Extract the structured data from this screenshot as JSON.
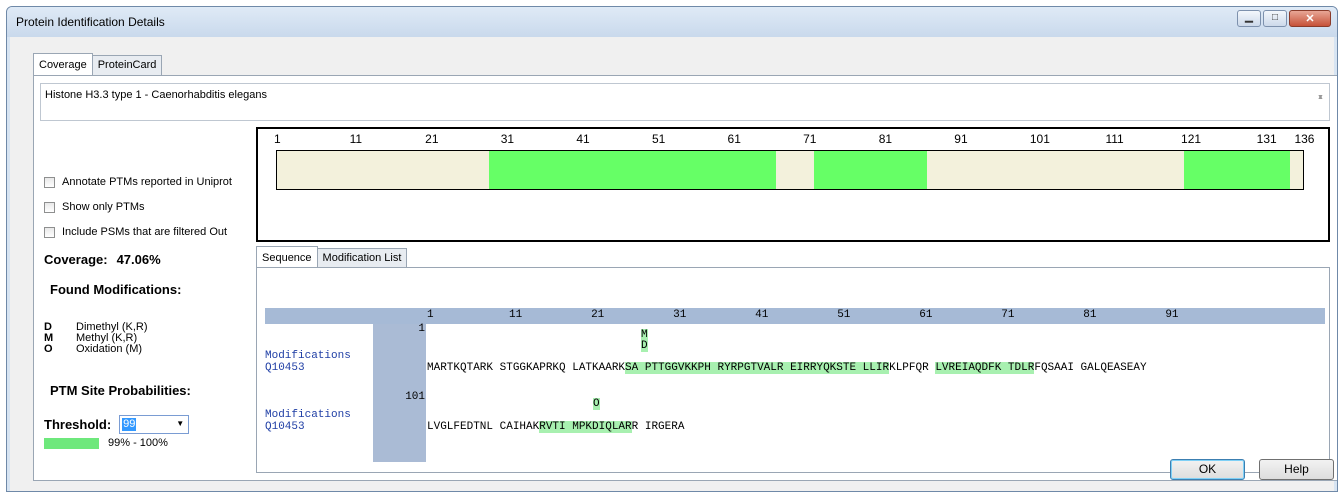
{
  "window": {
    "title": "Protein Identification Details"
  },
  "tabs": [
    {
      "label": "Coverage"
    },
    {
      "label": "ProteinCard"
    }
  ],
  "description": "Histone H3.3 type 1 - Caenorhabditis elegans",
  "options": {
    "annotate_ptms": "Annotate PTMs reported in Uniprot",
    "show_only_ptms": "Show only PTMs",
    "include_filtered": "Include PSMs that are filtered Out"
  },
  "coverage": {
    "label": "Coverage:",
    "value": "47.06%"
  },
  "found_modifications": {
    "title": "Found Modifications:",
    "items": [
      {
        "code": "D",
        "name": "Dimethyl (K,R)"
      },
      {
        "code": "M",
        "name": "Methyl (K,R)"
      },
      {
        "code": "O",
        "name": "Oxidation (M)"
      }
    ]
  },
  "ptm": {
    "title": "PTM Site Probabilities:",
    "threshold_label": "Threshold:",
    "threshold_value": "99",
    "legend_label": "99% - 100%",
    "legend_color": "#6ee87c"
  },
  "coverage_map": {
    "length": 136,
    "ticks": [
      "1",
      "11",
      "21",
      "31",
      "41",
      "51",
      "61",
      "71",
      "81",
      "91",
      "101",
      "111",
      "121",
      "131",
      "136"
    ],
    "covered_color": "#66ff66",
    "uncovered_color": "#f3f1dc",
    "covered_ranges": [
      [
        29,
        66
      ],
      [
        72,
        86
      ],
      [
        121,
        134
      ]
    ]
  },
  "inner_tabs": [
    {
      "label": "Sequence"
    },
    {
      "label": "Modification List"
    }
  ],
  "sequence_header": [
    "1",
    "11",
    "21",
    "31",
    "41",
    "51",
    "61",
    "71",
    "81",
    "91"
  ],
  "sequence": {
    "blocks": [
      {
        "start": "1",
        "mod_label": "Modifications",
        "accession": "Q10453",
        "mod_markers": [
          "M",
          "D"
        ],
        "segments": [
          {
            "text": "MARTKQTARK STGGKAPRKQ LATKAARK",
            "covered": false
          },
          {
            "text": "SA PTTGGVKKPH RYRPGTVALR EIRRYQKSTE LLIR",
            "covered": true
          },
          {
            "text": "KLPFQR ",
            "covered": false
          },
          {
            "text": "LVREIAQDFK TDLR",
            "covered": true
          },
          {
            "text": "FQSAAI GALQEASEAY",
            "covered": false
          }
        ]
      },
      {
        "start": "101",
        "mod_label": "Modifications",
        "accession": "Q10453",
        "mod_markers": [
          "O"
        ],
        "segments": [
          {
            "text": "LVGLFEDTNL CAIHAK",
            "covered": false
          },
          {
            "text": "RVTI MPKDIQLAR",
            "covered": true
          },
          {
            "text": "R IRGERA",
            "covered": false
          }
        ]
      }
    ]
  },
  "buttons": {
    "ok": "OK",
    "help": "Help"
  }
}
